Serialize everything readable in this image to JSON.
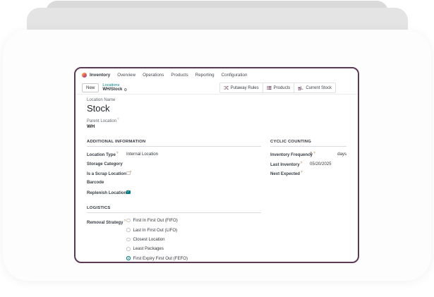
{
  "ui": {
    "help_marker": "?"
  },
  "app": {
    "name": "Inventory",
    "menus": [
      "Overview",
      "Operations",
      "Products",
      "Reporting",
      "Configuration"
    ]
  },
  "control_panel": {
    "new_button": "New",
    "breadcrumb": {
      "parent": "Locations",
      "current": "WH/Stock"
    },
    "smart_buttons": [
      {
        "label": "Putaway Rules",
        "icon": "shuffle-icon"
      },
      {
        "label": "Products",
        "icon": "list-icon"
      },
      {
        "label": "Current Stock",
        "icon": "forklift-icon"
      }
    ]
  },
  "form": {
    "location_name_label": "Location Name",
    "location_name": "Stock",
    "parent_location_label": "Parent Location",
    "parent_location": "WH",
    "additional_information": {
      "title": "ADDITIONAL INFORMATION",
      "fields": [
        {
          "label": "Location Type",
          "value": "Internal Location",
          "help": true
        },
        {
          "label": "Storage Category",
          "value": "",
          "help": false
        },
        {
          "label": "Is a Scrap Location?",
          "checkbox": false,
          "help": true
        },
        {
          "label": "Barcode",
          "value": "",
          "help": false
        },
        {
          "label": "Replenish Location",
          "checkbox": true,
          "help": true
        }
      ]
    },
    "cyclic_counting": {
      "title": "CYCLIC COUNTING",
      "fields": [
        {
          "label": "Inventory Frequency",
          "value": "0",
          "suffix": "days",
          "help": true
        },
        {
          "label": "Last Inventory",
          "value": "05/20/2025",
          "help": true
        },
        {
          "label": "Next Expected",
          "value": "",
          "help": true
        }
      ]
    },
    "logistics": {
      "title": "LOGISTICS",
      "removal_strategy_label": "Removal Strategy",
      "options": [
        {
          "label": "First In First Out (FIFO)",
          "selected": false
        },
        {
          "label": "Last In First Out (LIFO)",
          "selected": false
        },
        {
          "label": "Closest Location",
          "selected": false
        },
        {
          "label": "Least Packages",
          "selected": false
        },
        {
          "label": "First Expiry First Out (FEFO)",
          "selected": true
        }
      ]
    }
  },
  "colors": {
    "accent": "#017e84",
    "window_border": "#5c3a56",
    "help_marker_color": "#c8965c",
    "brand_plum": "#714b67"
  }
}
